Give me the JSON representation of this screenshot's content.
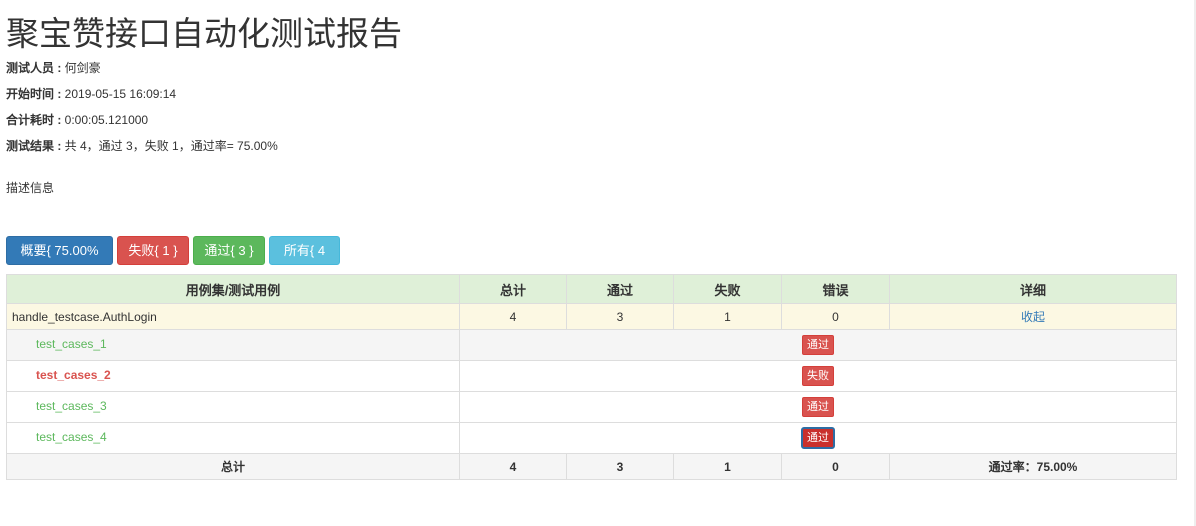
{
  "report": {
    "title": "聚宝赞接口自动化测试报告",
    "attributes": [
      {
        "label": "测试人员 :",
        "value": " 何剑豪"
      },
      {
        "label": "开始时间 :",
        "value": " 2019-05-15 16:09:14"
      },
      {
        "label": "合计耗时 :",
        "value": " 0:00:05.121000"
      },
      {
        "label": "测试结果 :",
        "value": " 共 4，通过 3，失败 1，通过率= 75.00%"
      }
    ],
    "description": "描述信息"
  },
  "filters": {
    "summary": "概要{ 75.00% }",
    "fail": "失败{ 1 }",
    "pass": "通过{ 3 }",
    "all": "所有{ 4 }"
  },
  "table": {
    "headers": [
      "用例集/测试用例",
      "总计",
      "通过",
      "失败",
      "错误",
      "详细"
    ],
    "suite": {
      "name": "handle_testcase.AuthLogin",
      "total": "4",
      "pass": "3",
      "fail": "1",
      "error": "0",
      "detail": "收起"
    },
    "cases": [
      {
        "name": "test_cases_1",
        "status": "通过"
      },
      {
        "name": "test_cases_2",
        "status": "失败"
      },
      {
        "name": "test_cases_3",
        "status": "通过"
      },
      {
        "name": "test_cases_4",
        "status": "通过"
      }
    ],
    "totals": {
      "label": "总计",
      "total": "4",
      "pass": "3",
      "fail": "1",
      "error": "0",
      "rate": "通过率：75.00%"
    }
  },
  "colors": {
    "primary": "#337ab7",
    "danger": "#d9534f",
    "success": "#5cb85c",
    "info": "#5bc0de",
    "header_bg": "#dff0d8",
    "suite_bg": "#fcf8e3"
  }
}
